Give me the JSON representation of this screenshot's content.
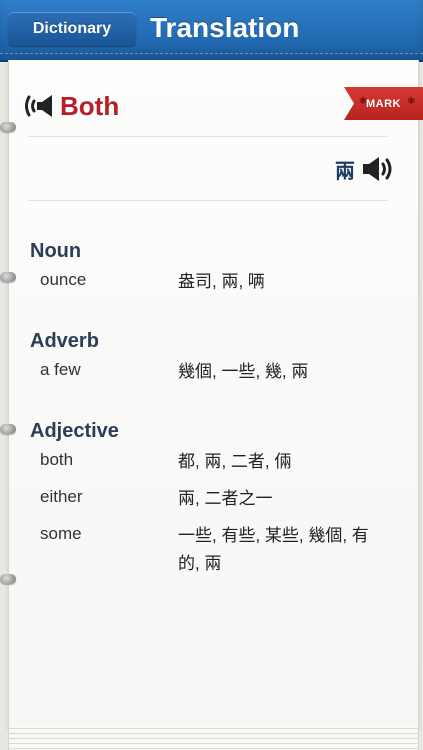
{
  "nav": {
    "back_label": "Dictionary",
    "title": "Translation"
  },
  "word": "Both",
  "mark_label": "MARK",
  "translation": "兩",
  "sections": [
    {
      "pos": "Noun",
      "entries": [
        {
          "en": "ounce",
          "zh": "盎司, 兩, 唡"
        }
      ]
    },
    {
      "pos": "Adverb",
      "entries": [
        {
          "en": "a few",
          "zh": "幾個, 一些, 幾, 兩"
        }
      ]
    },
    {
      "pos": "Adjective",
      "entries": [
        {
          "en": "both",
          "zh": "都, 兩, 二者, 倆"
        },
        {
          "en": "either",
          "zh": "兩, 二者之一"
        },
        {
          "en": "some",
          "zh": "一些, 有些, 某些, 幾個, 有的, 兩"
        }
      ]
    }
  ],
  "colors": {
    "accent": "#b51f26",
    "header": "#1b5fa5",
    "pos": "#2c3e57"
  }
}
